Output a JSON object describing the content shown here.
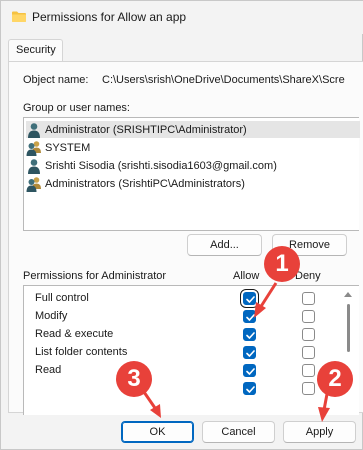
{
  "window": {
    "title": "Permissions for Allow an app"
  },
  "tabs": [
    {
      "label": "Security"
    }
  ],
  "object": {
    "label": "Object name:",
    "value": "C:\\Users\\srish\\OneDrive\\Documents\\ShareX\\Scre"
  },
  "groups": {
    "label": "Group or user names:",
    "items": [
      {
        "name": "Administrator (SRISHTIPC\\Administrator)",
        "icon": "user-icon",
        "selected": true
      },
      {
        "name": "SYSTEM",
        "icon": "group-icon",
        "selected": false
      },
      {
        "name": "Srishti Sisodia (srishti.sisodia1603@gmail.com)",
        "icon": "user-icon",
        "selected": false
      },
      {
        "name": "Administrators (SrishtiPC\\Administrators)",
        "icon": "group-icon",
        "selected": false
      }
    ]
  },
  "buttons": {
    "add": "Add...",
    "remove": "Remove",
    "ok": "OK",
    "cancel": "Cancel",
    "apply": "Apply"
  },
  "permissions": {
    "header": "Permissions for Administrator",
    "allow_label": "Allow",
    "deny_label": "Deny",
    "rows": [
      {
        "name": "Full control",
        "allow": true,
        "deny": false
      },
      {
        "name": "Modify",
        "allow": true,
        "deny": false
      },
      {
        "name": "Read & execute",
        "allow": true,
        "deny": false
      },
      {
        "name": "List folder contents",
        "allow": true,
        "deny": false
      },
      {
        "name": "Read",
        "allow": true,
        "deny": false
      },
      {
        "name": "",
        "allow": true,
        "deny": false
      }
    ]
  },
  "annotations": {
    "badge_1": "1",
    "badge_2": "2",
    "badge_3": "3",
    "color": "#e8413a"
  },
  "colors": {
    "accent": "#0067c0",
    "annotation": "#e8413a"
  }
}
